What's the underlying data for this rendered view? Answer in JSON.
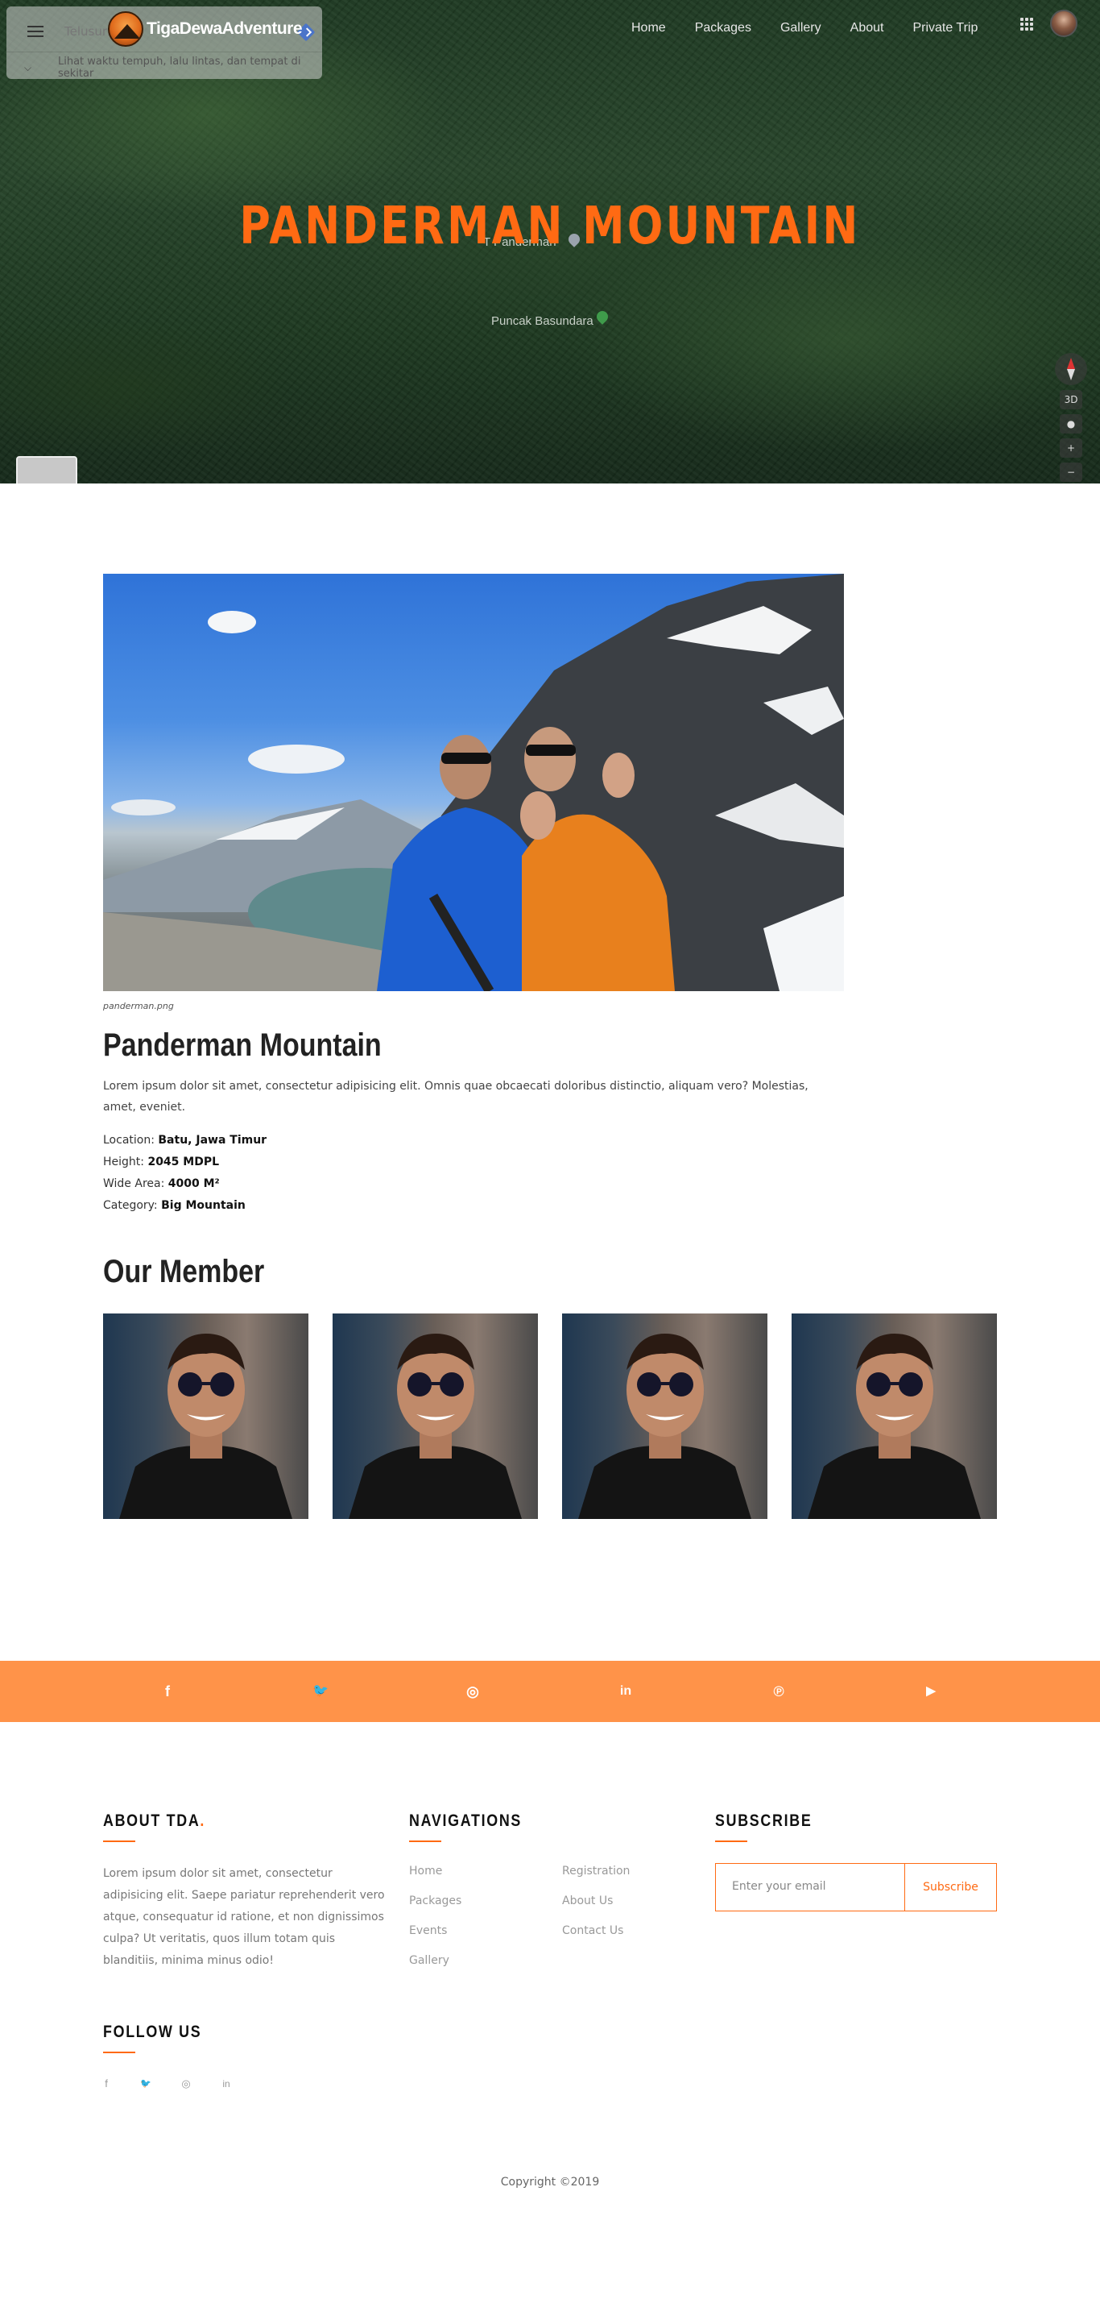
{
  "maps_overlay": {
    "search_placeholder": "Telusuri",
    "hint": "Lihat waktu tempuh, lalu lintas, dan tempat di sekitar",
    "labels": [
      "Puncak Basundara"
    ],
    "partial_label": "T Panderman",
    "controls": {
      "tilt": "3D",
      "zoom_in": "+",
      "zoom_out": "−"
    }
  },
  "brand": {
    "name": "TigaDewaAdventure"
  },
  "nav": {
    "items": [
      {
        "label": "Home"
      },
      {
        "label": "Packages"
      },
      {
        "label": "Gallery"
      },
      {
        "label": "About"
      },
      {
        "label": "Private Trip"
      }
    ]
  },
  "hero": {
    "title": "PANDERMAN MOUNTAIN"
  },
  "mountain": {
    "caption": "panderman.png",
    "title": "Panderman Mountain",
    "description": "Lorem ipsum dolor sit amet, consectetur adipisicing elit. Omnis quae obcaecati doloribus distinctio, aliquam vero? Molestias, amet, eveniet.",
    "facts": [
      {
        "label": "Location: ",
        "value": "Batu, Jawa Timur"
      },
      {
        "label": "Height: ",
        "value": "2045 MDPL"
      },
      {
        "label": "Wide Area: ",
        "value": "4000 M²"
      },
      {
        "label": "Category: ",
        "value": "Big Mountain"
      }
    ]
  },
  "members": {
    "title": "Our Member",
    "count": 4
  },
  "social_bar": {
    "icons": [
      "facebook-icon",
      "twitter-icon",
      "instagram-icon",
      "linkedin-icon",
      "pinterest-icon",
      "youtube-icon"
    ],
    "glyphs": [
      "f",
      "🐦",
      "◎",
      "in",
      "℗",
      "▶"
    ]
  },
  "footer": {
    "about": {
      "heading_prefix": "ABOUT ",
      "heading_bold": "TDA",
      "heading_dot": ".",
      "text": "Lorem ipsum dolor sit amet, consectetur adipisicing elit. Saepe pariatur reprehenderit vero atque, consequatur id ratione, et non dignissimos culpa? Ut veritatis, quos illum totam quis blanditiis, minima minus odio!"
    },
    "navigations": {
      "heading": "NAVIGATIONS",
      "col1": [
        "Home",
        "Packages",
        "Events",
        "Gallery"
      ],
      "col2": [
        "Registration",
        "About Us",
        "Contact Us"
      ]
    },
    "subscribe": {
      "heading": "SUBSCRIBE",
      "placeholder": "Enter your email",
      "button": "Subscribe"
    },
    "follow": {
      "heading": "FOLLOW US",
      "glyphs": [
        "f",
        "🐦",
        "◎",
        "in"
      ]
    },
    "copyright": "Copyright ©2019"
  },
  "colors": {
    "accent": "#ff6a13",
    "social_bar": "#ff9349"
  }
}
